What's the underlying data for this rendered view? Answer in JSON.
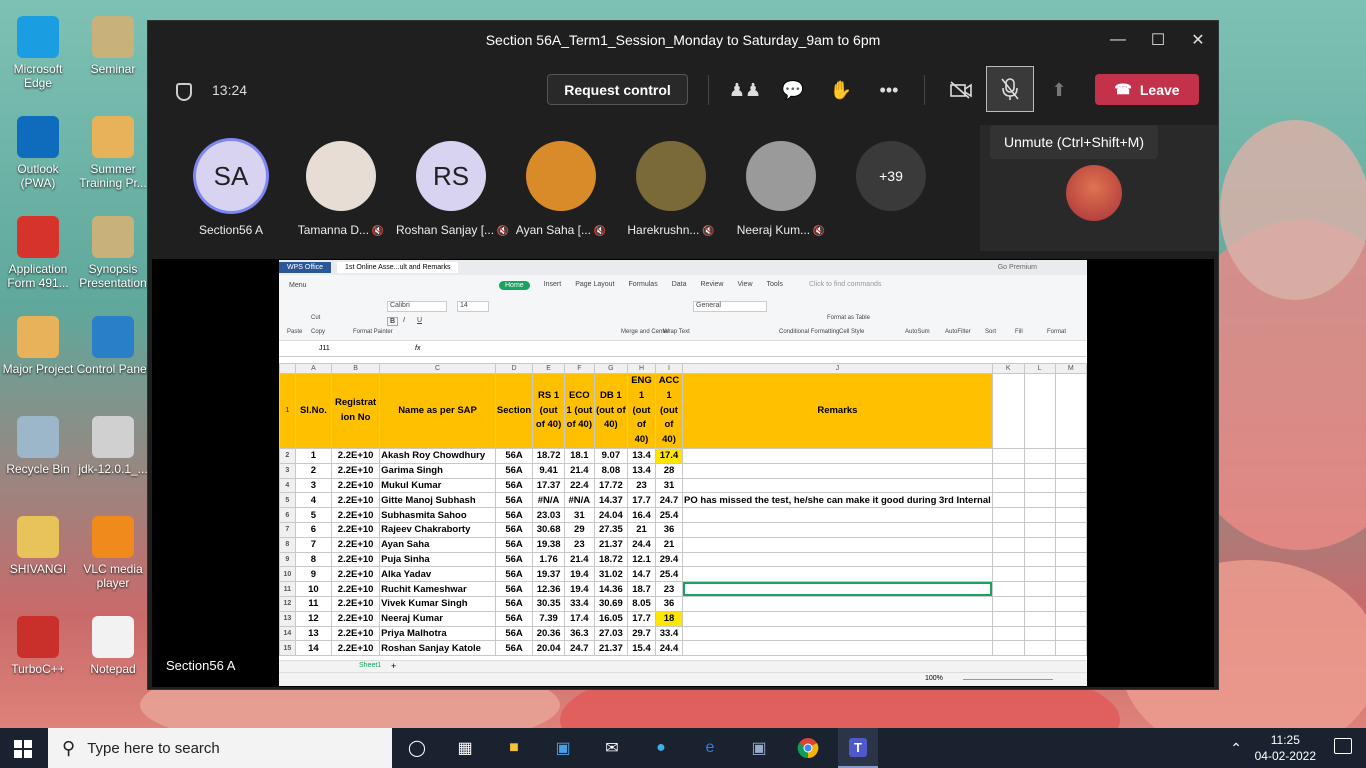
{
  "desktop": {
    "icons": [
      {
        "label": "Microsoft Edge",
        "icon": "edge-icon",
        "color": "#1b9de2"
      },
      {
        "label": "Seminar",
        "icon": "document-icon",
        "color": "#c9b27a"
      },
      {
        "label": "Outlook (PWA)",
        "icon": "outlook-icon",
        "color": "#0f6cbd"
      },
      {
        "label": "Summer Training Pr...",
        "icon": "pdf-icon",
        "color": "#e8b25a"
      },
      {
        "label": "Application Form 491...",
        "icon": "pdf-icon",
        "color": "#d6342b"
      },
      {
        "label": "Synopsis Presentation",
        "icon": "document-icon",
        "color": "#c9b27a"
      },
      {
        "label": "Major Project",
        "icon": "pdf-icon",
        "color": "#e8b25a"
      },
      {
        "label": "Control Panel",
        "icon": "control-panel-icon",
        "color": "#2a7fc9"
      },
      {
        "label": "Recycle Bin",
        "icon": "recycle-bin-icon",
        "color": "#9bb7c9"
      },
      {
        "label": "jdk-12.0.1_...",
        "icon": "java-icon",
        "color": "#d0d0d0"
      },
      {
        "label": "SHIVANGI",
        "icon": "user-folder-icon",
        "color": "#e8c35a"
      },
      {
        "label": "VLC media player",
        "icon": "vlc-icon",
        "color": "#f08a1c"
      },
      {
        "label": "TurboC++",
        "icon": "turboc-icon",
        "color": "#c9302c"
      },
      {
        "label": "Notepad",
        "icon": "notepad-icon",
        "color": "#f2f2f2"
      }
    ]
  },
  "teams": {
    "title": "Section 56A_Term1_Session_Monday to Saturday_9am to 6pm",
    "timer": "13:24",
    "request_control": "Request control",
    "leave": "Leave",
    "tooltip": "Unmute (Ctrl+Shift+M)",
    "participants": [
      {
        "initials": "SA",
        "name": "Section56 A",
        "bg": "#d7d3f0",
        "muted": false,
        "ring": true
      },
      {
        "initials": "",
        "name": "Tamanna D...",
        "bg": "#e8ddd4",
        "muted": true,
        "ring": false
      },
      {
        "initials": "RS",
        "name": "Roshan Sanjay [...",
        "bg": "#d7d3f0",
        "muted": true,
        "ring": false
      },
      {
        "initials": "",
        "name": "Ayan Saha [...",
        "bg": "#d98b2a",
        "muted": true,
        "ring": false
      },
      {
        "initials": "",
        "name": "Harekrushn...",
        "bg": "#7a6a3a",
        "muted": true,
        "ring": false
      },
      {
        "initials": "",
        "name": "Neeraj Kum...",
        "bg": "#9a9a9a",
        "muted": true,
        "ring": false
      },
      {
        "initials": "+39",
        "name": "",
        "bg": "#3a3a3a",
        "muted": false,
        "ring": false
      }
    ],
    "stage_label": "Section56 A"
  },
  "wps": {
    "app_tab": "WPS Office",
    "doc_tab": "1st Online Asse...ult and Remarks",
    "premium": "Go Premium",
    "ribbon_tabs": [
      "Home",
      "Insert",
      "Page Layout",
      "Formulas",
      "Data",
      "Review",
      "View",
      "Tools"
    ],
    "find_placeholder": "Click to find commands",
    "menu": "Menu",
    "font": "Calibri",
    "font_size": "14",
    "number_format": "General",
    "cell_ref": "J11",
    "fx": "fx",
    "ribbon_labels": [
      "Paste",
      "Cut",
      "Copy",
      "Format Painter",
      "Merge and Center",
      "Wrap Text",
      "Conditional Formatting",
      "Format as Table",
      "Cell Style",
      "AutoSum",
      "AutoFilter",
      "Sort",
      "Fill",
      "Format"
    ],
    "col_letters": [
      "A",
      "B",
      "C",
      "D",
      "E",
      "F",
      "G",
      "H",
      "I",
      "J",
      "K",
      "L",
      "M"
    ],
    "headers": [
      "Sl.No.",
      "Registrat ion No",
      "Name as per SAP",
      "Section",
      "RS 1 (out of 40)",
      "ECO 1 (out of 40)",
      "DB 1 (out of 40)",
      "ENG 1 (out of 40)",
      "ACC 1 (out of 40)",
      "Remarks"
    ],
    "rows": [
      {
        "n": "2",
        "cells": [
          "1",
          "2.2E+10",
          "Akash Roy Chowdhury",
          "56A",
          "18.72",
          "18.1",
          "9.07",
          "13.4",
          "17.4",
          ""
        ],
        "hl": true
      },
      {
        "n": "3",
        "cells": [
          "2",
          "2.2E+10",
          "Garima Singh",
          "56A",
          "9.41",
          "21.4",
          "8.08",
          "13.4",
          "28",
          ""
        ],
        "hl": false
      },
      {
        "n": "4",
        "cells": [
          "3",
          "2.2E+10",
          "Mukul Kumar",
          "56A",
          "17.37",
          "22.4",
          "17.72",
          "23",
          "31",
          ""
        ],
        "hl": false
      },
      {
        "n": "5",
        "cells": [
          "4",
          "2.2E+10",
          "Gitte Manoj Subhash",
          "56A",
          "#N/A",
          "#N/A",
          "14.37",
          "17.7",
          "24.7",
          "PO has missed the test, he/she can make it good during 3rd Internal"
        ],
        "hl": false
      },
      {
        "n": "6",
        "cells": [
          "5",
          "2.2E+10",
          "Subhasmita Sahoo",
          "56A",
          "23.03",
          "31",
          "24.04",
          "16.4",
          "25.4",
          ""
        ],
        "hl": false
      },
      {
        "n": "7",
        "cells": [
          "6",
          "2.2E+10",
          "Rajeev Chakraborty",
          "56A",
          "30.68",
          "29",
          "27.35",
          "21",
          "36",
          ""
        ],
        "hl": false
      },
      {
        "n": "8",
        "cells": [
          "7",
          "2.2E+10",
          "Ayan Saha",
          "56A",
          "19.38",
          "23",
          "21.37",
          "24.4",
          "21",
          ""
        ],
        "hl": false
      },
      {
        "n": "9",
        "cells": [
          "8",
          "2.2E+10",
          "Puja Sinha",
          "56A",
          "1.76",
          "21.4",
          "18.72",
          "12.1",
          "29.4",
          ""
        ],
        "hl": false
      },
      {
        "n": "10",
        "cells": [
          "9",
          "2.2E+10",
          "Alka Yadav",
          "56A",
          "19.37",
          "19.4",
          "31.02",
          "14.7",
          "25.4",
          ""
        ],
        "hl": false
      },
      {
        "n": "11",
        "cells": [
          "10",
          "2.2E+10",
          "Ruchit Kameshwar",
          "56A",
          "12.36",
          "19.4",
          "14.36",
          "18.7",
          "23",
          ""
        ],
        "hl": false,
        "sel": true
      },
      {
        "n": "12",
        "cells": [
          "11",
          "2.2E+10",
          "Vivek Kumar Singh",
          "56A",
          "30.35",
          "33.4",
          "30.69",
          "8.05",
          "36",
          ""
        ],
        "hl": false
      },
      {
        "n": "13",
        "cells": [
          "12",
          "2.2E+10",
          "Neeraj Kumar",
          "56A",
          "7.39",
          "17.4",
          "16.05",
          "17.7",
          "18",
          ""
        ],
        "hl": true
      },
      {
        "n": "14",
        "cells": [
          "13",
          "2.2E+10",
          "Priya Malhotra",
          "56A",
          "20.36",
          "36.3",
          "27.03",
          "29.7",
          "33.4",
          ""
        ],
        "hl": false
      },
      {
        "n": "15",
        "cells": [
          "14",
          "2.2E+10",
          "Roshan Sanjay Katole",
          "56A",
          "20.04",
          "24.7",
          "21.37",
          "15.4",
          "24.4",
          ""
        ],
        "hl": false
      }
    ],
    "sheet_tab": "Sheet1",
    "zoom": "100%"
  },
  "taskbar": {
    "search_placeholder": "Type here to search",
    "time": "11:25",
    "date": "04-02-2022"
  }
}
